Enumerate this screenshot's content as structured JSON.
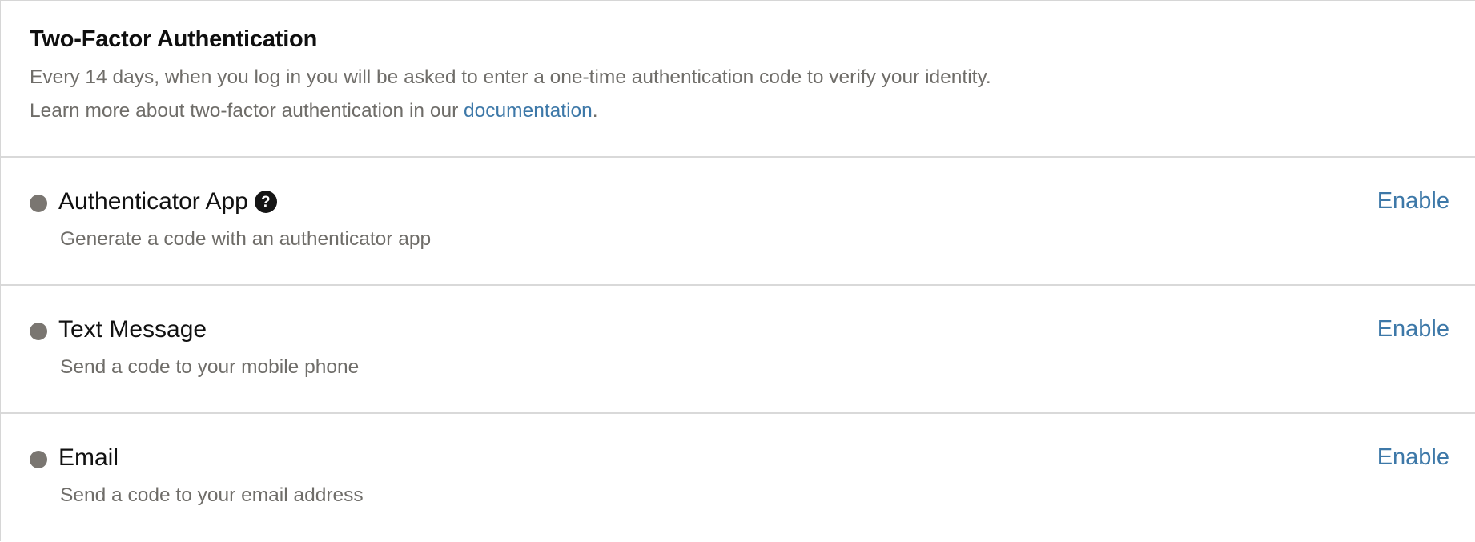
{
  "section": {
    "title": "Two-Factor Authentication",
    "description_line1": "Every 14 days, when you log in you will be asked to enter a one-time authentication code to verify your identity.",
    "description_line2_prefix": "Learn more about two-factor authentication in our ",
    "documentation_link": "documentation",
    "description_line2_suffix": "."
  },
  "methods": [
    {
      "name": "Authenticator App",
      "description": "Generate a code with an authenticator app",
      "action_label": "Enable",
      "help_icon": "question-circle-icon",
      "help_glyph": "?",
      "status_color": "#7a7671"
    },
    {
      "name": "Text Message",
      "description": "Send a code to your mobile phone",
      "action_label": "Enable",
      "status_color": "#7a7671"
    },
    {
      "name": "Email",
      "description": "Send a code to your email address",
      "action_label": "Enable",
      "status_color": "#7a7671"
    }
  ],
  "colors": {
    "link": "#3d78a8",
    "muted_text": "#6f6d69",
    "divider": "#d9d9d9",
    "status_dot": "#7a7671"
  }
}
